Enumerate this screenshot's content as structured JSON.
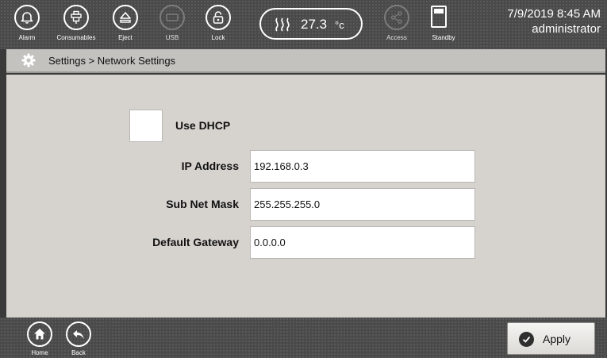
{
  "topbar": {
    "buttons": [
      {
        "label": "Alarm",
        "icon": "bell-icon",
        "enabled": true
      },
      {
        "label": "Consumables",
        "icon": "consumables-icon",
        "enabled": true
      },
      {
        "label": "Eject",
        "icon": "eject-icon",
        "enabled": true
      },
      {
        "label": "USB",
        "icon": "usb-icon",
        "enabled": false
      },
      {
        "label": "Lock",
        "icon": "lock-icon",
        "enabled": true
      },
      {
        "label": "Access",
        "icon": "share-icon",
        "enabled": false
      },
      {
        "label": "Standby",
        "icon": "standby-icon",
        "enabled": true
      }
    ],
    "temperature": {
      "value": "27.3",
      "unit": "°c",
      "icon": "heat-icon"
    },
    "date_time": "7/9/2019 8:45 AM",
    "user": "administrator"
  },
  "breadcrumb": {
    "icon": "gear-icon",
    "text": "Settings > Network Settings"
  },
  "form": {
    "use_dhcp": {
      "label": "Use DHCP",
      "checked": false
    },
    "fields": [
      {
        "label": "IP Address",
        "value": "192.168.0.3"
      },
      {
        "label": "Sub Net Mask",
        "value": "255.255.255.0"
      },
      {
        "label": "Default Gateway",
        "value": "0.0.0.0"
      }
    ]
  },
  "bottombar": {
    "home_label": "Home",
    "back_label": "Back",
    "apply_label": "Apply"
  },
  "colors": {
    "bar": "#4a4a4a",
    "content_bg": "#d6d3cf",
    "breadcrumb_bg": "#c4c2bf"
  }
}
